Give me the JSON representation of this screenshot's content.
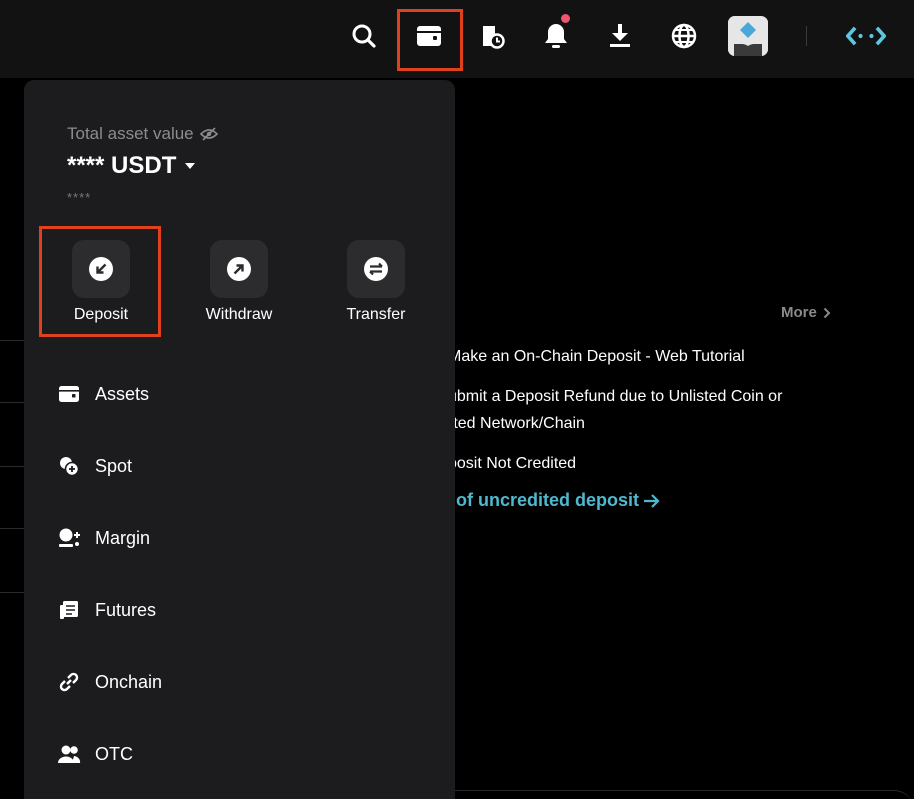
{
  "topbar": {
    "icons": [
      "search-icon",
      "wallet-icon",
      "order-history-icon",
      "bell-icon",
      "download-icon",
      "globe-icon",
      "avatar",
      "brand-logo-icon"
    ],
    "notification_dot_color": "#f0566e"
  },
  "wallet_panel": {
    "total_label": "Total asset value",
    "value": "**** USDT",
    "sub_value": "****",
    "actions": [
      {
        "label": "Deposit",
        "icon": "deposit-icon"
      },
      {
        "label": "Withdraw",
        "icon": "withdraw-icon"
      },
      {
        "label": "Transfer",
        "icon": "transfer-icon"
      }
    ],
    "menu": [
      {
        "label": "Assets",
        "icon": "wallet-icon"
      },
      {
        "label": "Spot",
        "icon": "spot-icon"
      },
      {
        "label": "Margin",
        "icon": "margin-icon"
      },
      {
        "label": "Futures",
        "icon": "futures-icon"
      },
      {
        "label": "Onchain",
        "icon": "onchain-icon"
      },
      {
        "label": "OTC",
        "icon": "otc-icon"
      }
    ]
  },
  "background": {
    "more_label": "More",
    "faq": [
      "Make an On-Chain Deposit - Web Tutorial",
      "ubmit a Deposit Refund due to Unlisted Coin or",
      "rted Network/Chain",
      "posit Not Credited"
    ],
    "faq_link": "of uncredited deposit"
  },
  "colors": {
    "highlight": "#e0401c",
    "link": "#4fb8cf",
    "panel_bg": "#1c1c1e",
    "button_bg": "#2c2c2e"
  }
}
